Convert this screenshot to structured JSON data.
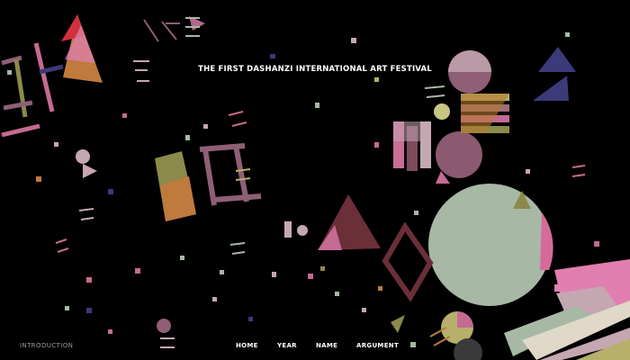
{
  "header": {
    "title": "THE FIRST DASHANZI INTERNATIONAL ART FESTIVAL"
  },
  "footer": {
    "introduction_label": "INTRODUCTION",
    "nav": [
      {
        "label": "HOME"
      },
      {
        "label": "YEAR"
      },
      {
        "label": "NAME"
      },
      {
        "label": "ARGUMENT"
      }
    ]
  },
  "colors": {
    "background": "#000000",
    "sage": "#a7b8a5",
    "mauve": "#8f5f76",
    "pink": "#c56a93",
    "ochre": "#c07a3d",
    "navy": "#3c3a78",
    "maroon": "#6b2f39",
    "rose": "#e07fb0",
    "olive": "#8c8a4a"
  }
}
